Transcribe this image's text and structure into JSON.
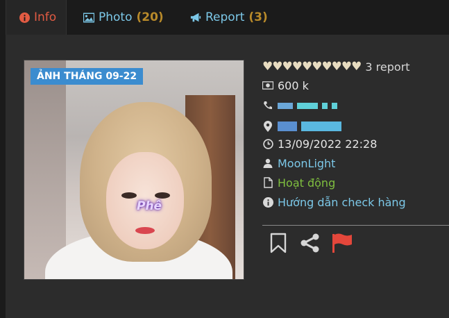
{
  "tabs": [
    {
      "label": "Info",
      "count": ""
    },
    {
      "label": "Photo",
      "count": "(20)"
    },
    {
      "label": "Report",
      "count": "(3)"
    }
  ],
  "photo": {
    "badge": "ẢNH THÁNG 09-22",
    "sticker": "Phê"
  },
  "info": {
    "report": "3 report",
    "price": "600 k",
    "datetime": "13/09/2022 22:28",
    "user": "MoonLight",
    "status": "Hoạt động",
    "guide": "Hướng dẫn check hàng"
  },
  "colors": {
    "accent_red": "#e25b43",
    "accent_blue": "#7cc8e8",
    "count_gold": "#b88a2a",
    "status_green": "#7fbf3f",
    "flag_red": "#e4473b"
  },
  "icons": [
    "info-circle-icon",
    "image-icon",
    "bullhorn-icon",
    "money-icon",
    "phone-icon",
    "map-marker-icon",
    "clock-icon",
    "user-icon",
    "file-icon",
    "info-circle-icon",
    "bookmark-icon",
    "share-icon",
    "flag-icon"
  ]
}
